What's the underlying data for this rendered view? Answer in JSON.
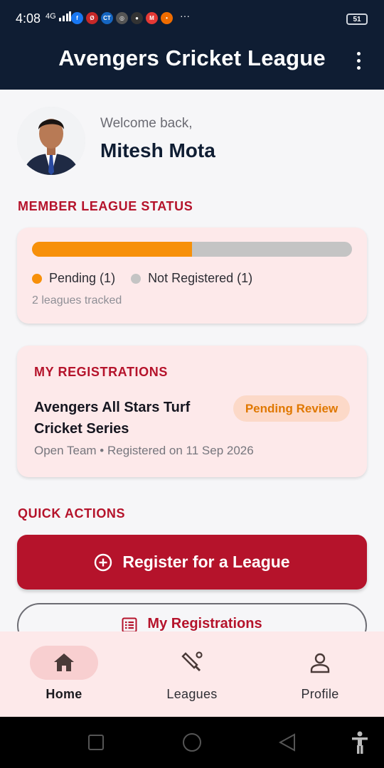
{
  "status_bar": {
    "time": "4:08",
    "network": "4G",
    "battery": "51",
    "more": "···",
    "app_icons": [
      {
        "name": "facebook-icon",
        "color": "#1877f2",
        "glyph": "f"
      },
      {
        "name": "app-icon-2",
        "color": "#c62828",
        "glyph": "Ø"
      },
      {
        "name": "ct-icon",
        "color": "#1565c0",
        "glyph": "CT"
      },
      {
        "name": "app-icon-4",
        "color": "#555555",
        "glyph": "◎"
      },
      {
        "name": "app-icon-5",
        "color": "#333333",
        "glyph": "●"
      },
      {
        "name": "app-icon-6",
        "color": "#e53935",
        "glyph": "M"
      },
      {
        "name": "app-icon-7",
        "color": "#ef6c00",
        "glyph": "•"
      }
    ]
  },
  "app_bar": {
    "title": "Avengers Cricket League",
    "menu_icon": "more-vert-icon"
  },
  "user": {
    "welcome": "Welcome back,",
    "name": "Mitesh Mota"
  },
  "status_section": {
    "title": "MEMBER LEAGUE STATUS",
    "pending_fraction": 0.5,
    "pending_color": "#f7900a",
    "not_registered_color": "#c4c4c4",
    "legend": [
      {
        "label": "Pending (1)",
        "color": "#f7900a"
      },
      {
        "label": "Not Registered (1)",
        "color": "#c4c4c4"
      }
    ],
    "tracked": "2 leagues tracked"
  },
  "registrations": {
    "title": "MY REGISTRATIONS",
    "items": [
      {
        "league": "Avengers All Stars Turf Cricket Series",
        "status": "Pending Review",
        "meta": "Open Team • Registered on 11 Sep 2026"
      }
    ]
  },
  "quick_actions": {
    "title": "QUICK ACTIONS",
    "primary_label": "Register for a League",
    "secondary_label": "My Registrations"
  },
  "bottom_nav": [
    {
      "label": "Home",
      "icon": "home-icon",
      "active": true
    },
    {
      "label": "Leagues",
      "icon": "cricket-bat-icon",
      "active": false
    },
    {
      "label": "Profile",
      "icon": "person-icon",
      "active": false
    }
  ],
  "colors": {
    "header_bg": "#0f1d33",
    "accent": "#b5132b",
    "card_bg": "#fde9ea",
    "pending_badge": "#e07800"
  }
}
